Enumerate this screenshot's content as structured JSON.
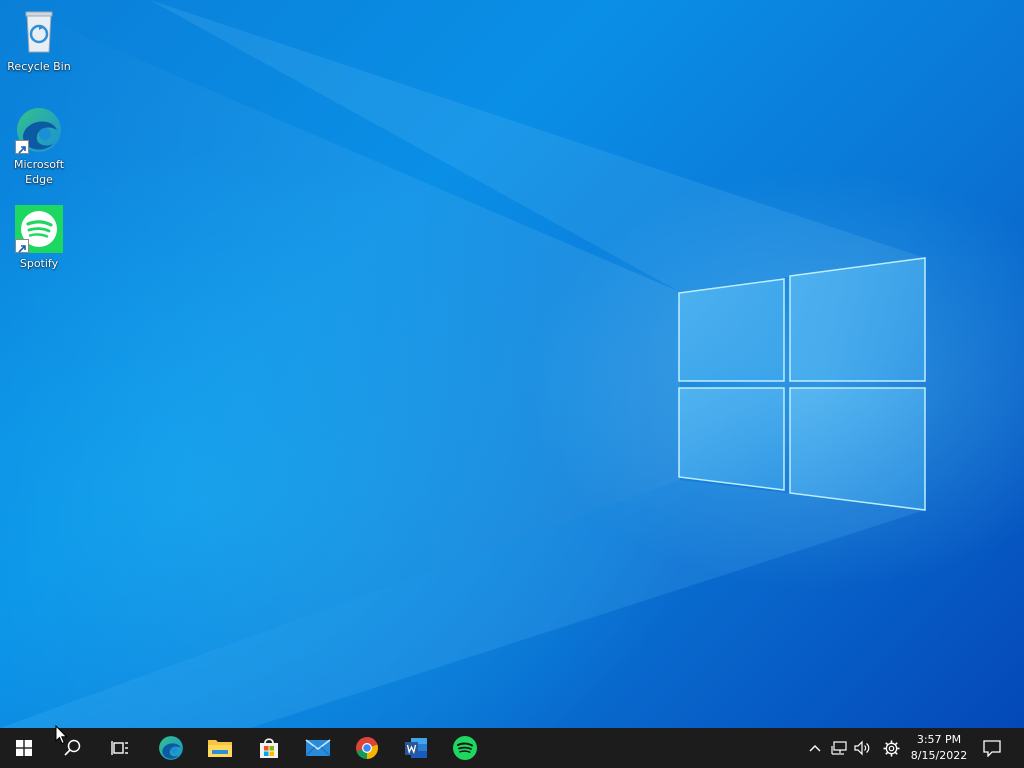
{
  "desktop": {
    "icons": [
      {
        "label": "Recycle Bin",
        "icon": "recycle-bin-icon"
      },
      {
        "label": "Microsoft\nEdge",
        "icon": "edge-icon"
      },
      {
        "label": "Spotify",
        "icon": "spotify-icon"
      }
    ]
  },
  "taskbar": {
    "items": [
      {
        "name": "Start",
        "icon": "windows-start-icon"
      },
      {
        "name": "Search",
        "icon": "search-icon"
      },
      {
        "name": "Task View",
        "icon": "task-view-icon"
      },
      {
        "name": "Microsoft Edge",
        "icon": "edge-icon"
      },
      {
        "name": "File Explorer",
        "icon": "folder-icon"
      },
      {
        "name": "Microsoft Store",
        "icon": "store-icon"
      },
      {
        "name": "Mail",
        "icon": "mail-icon"
      },
      {
        "name": "Google Chrome",
        "icon": "chrome-icon"
      },
      {
        "name": "Microsoft Word",
        "icon": "word-icon"
      },
      {
        "name": "Spotify",
        "icon": "spotify-icon"
      }
    ],
    "tray": {
      "icons": [
        "chevron-up-icon",
        "network-icon",
        "volume-icon",
        "gear-icon"
      ],
      "time": "3:57 PM",
      "date": "8/15/2022",
      "notification_icon": "action-center-icon"
    }
  },
  "colors": {
    "taskbar_bg": "#1c1c1c",
    "wallpaper_blue": "#0a7fd8",
    "spotify_green": "#1ed760",
    "word_blue": "#2b579a"
  }
}
